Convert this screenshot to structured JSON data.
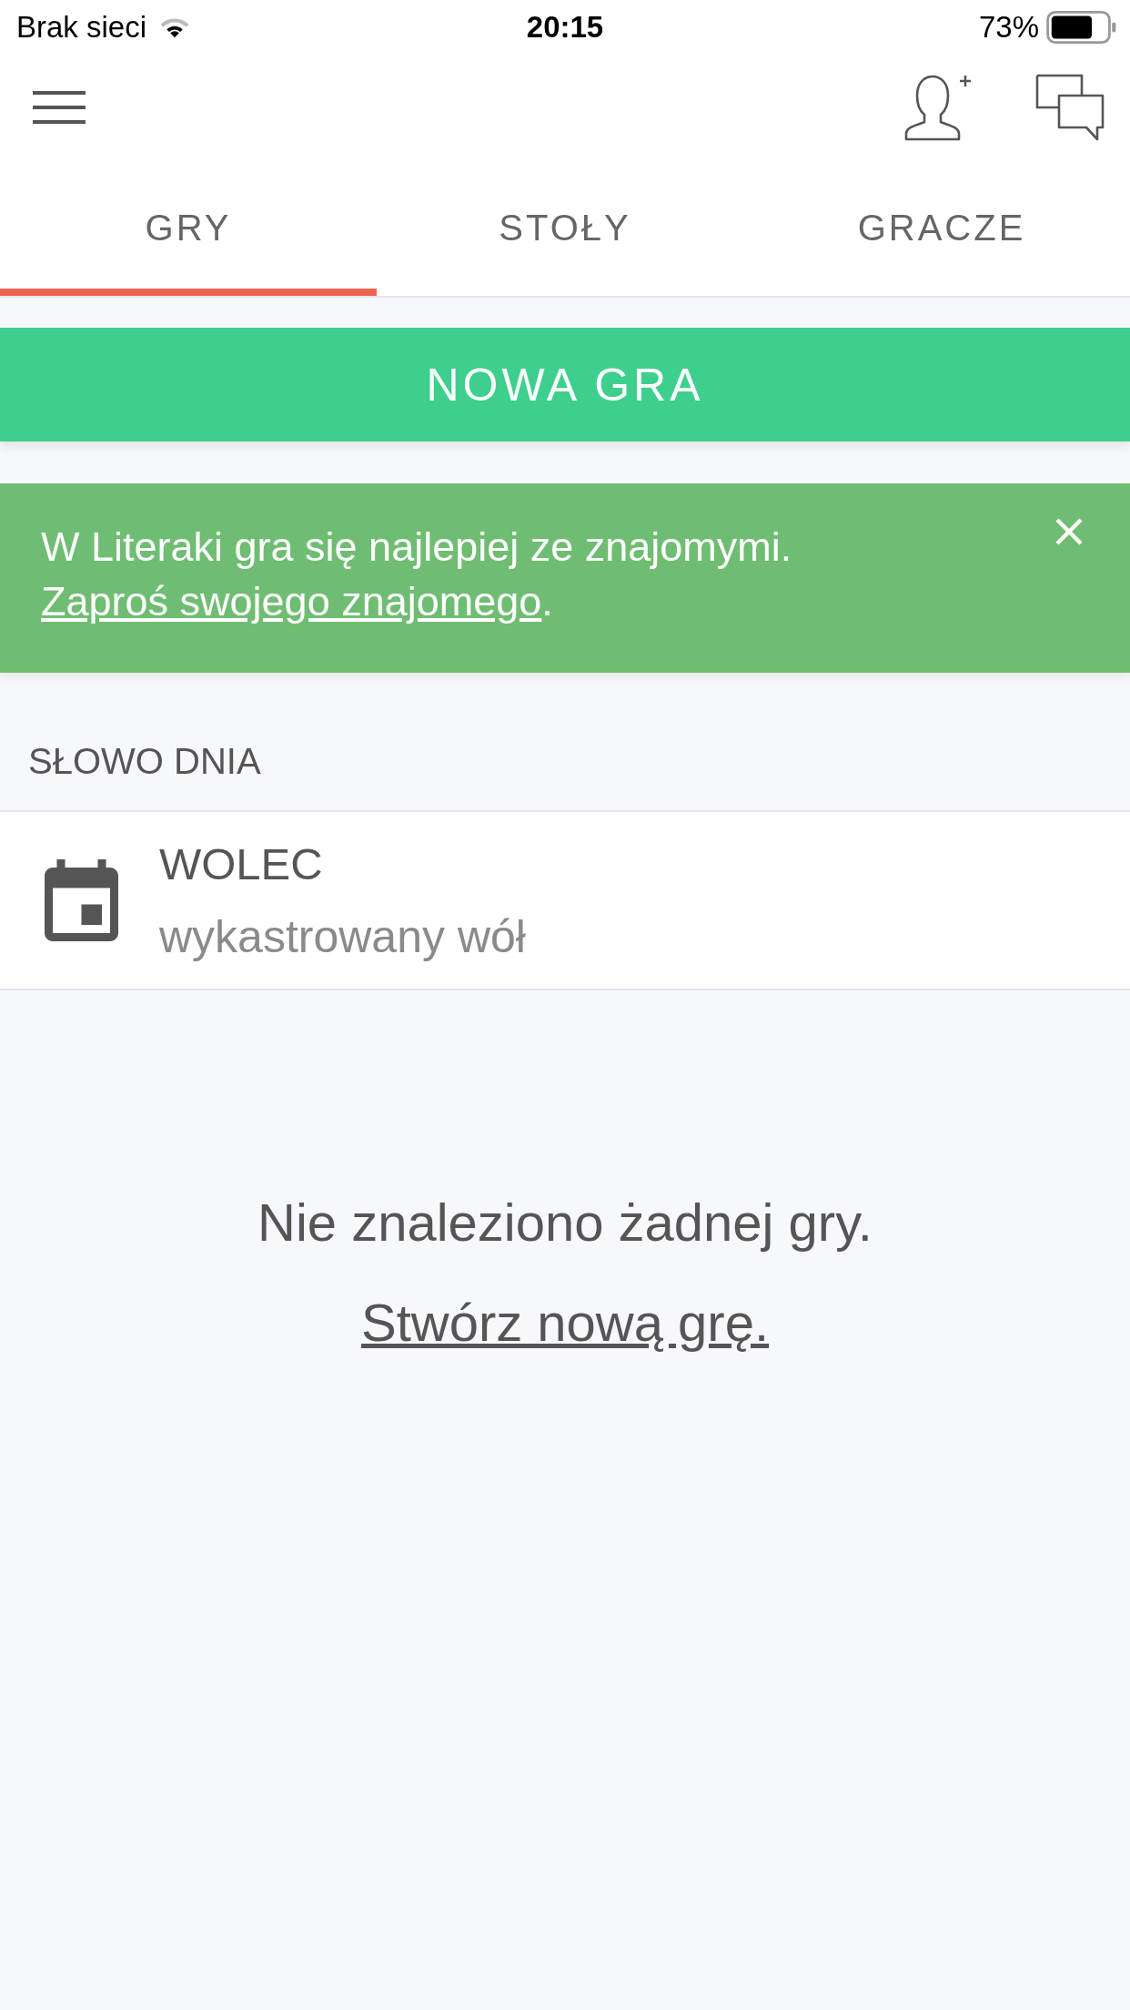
{
  "status_bar": {
    "carrier": "Brak sieci",
    "time": "20:15",
    "battery": "73%"
  },
  "tabs": [
    {
      "label": "GRY",
      "selected": true
    },
    {
      "label": "STOŁY",
      "selected": false
    },
    {
      "label": "GRACZE",
      "selected": false
    }
  ],
  "new_game_button": {
    "label": "NOWA GRA"
  },
  "invite_banner": {
    "message": "W Literaki gra się najlepiej ze znajomymi.",
    "link": "Zaproś swojego znajomego",
    "message_end": "."
  },
  "word_of_day": {
    "heading": "SŁOWO DNIA",
    "word": "WOLEC",
    "definition": "wykastrowany wół"
  },
  "empty_state": {
    "message": "Nie znaleziono żadnej gry.",
    "link": "Stwórz nową grę."
  }
}
